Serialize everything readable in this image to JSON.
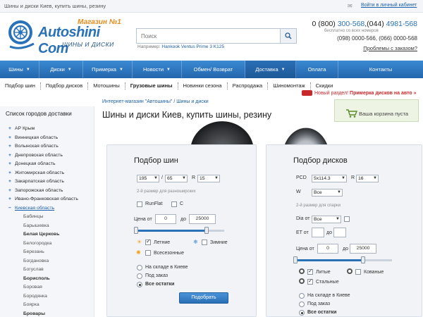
{
  "topbar": {
    "page_title": "Шины и диски Киев, купить шины, резину",
    "cabinet_link": "Войти в личный кабинет"
  },
  "header": {
    "logo_tagline": "Магазин №1",
    "logo_name": "Autoshini Com",
    "logo_sub": "ШИНЫ И ДИСКИ",
    "search_placeholder": "Поиск",
    "example_label": "Например:",
    "example_link": "Hankook Ventus Prime 3 K125",
    "phone_main_prefix": "0 (800)",
    "phone_main_num": "300-568",
    "phone_main_sep": ",(044)",
    "phone_main_num2": "4981-568",
    "phone_free_note": "бесплатно со всех номеров",
    "phone_secondary": "(098) 0000-566, (066) 0000-568",
    "problems_link": "Проблемы с заказом?"
  },
  "nav": [
    {
      "label": "Шины",
      "chevron": true
    },
    {
      "label": "Диски",
      "chevron": true
    },
    {
      "label": "Примерка",
      "chevron": true
    },
    {
      "label": "Новости",
      "chevron": true
    },
    {
      "label": "Обмен/ Возврат",
      "chevron": false
    },
    {
      "label": "Доставка",
      "chevron": true,
      "active": true
    },
    {
      "label": "Оплата",
      "chevron": false
    },
    {
      "label": "Контакты",
      "chevron": false
    }
  ],
  "subnav": [
    {
      "label": "Подбор шин"
    },
    {
      "label": "Подбор дисков"
    },
    {
      "label": "Мотошины"
    },
    {
      "label": "Грузовые шины",
      "bold": true
    },
    {
      "label": "Новинки сезона"
    },
    {
      "label": "Распродажа"
    },
    {
      "label": "Шиномонтаж"
    },
    {
      "label": "Скидки"
    }
  ],
  "promo": {
    "prefix": "Новый раздел!",
    "link": "Примерка дисков на авто »"
  },
  "breadcrumb": {
    "home": "Интернет-магазин \"Автошины\"",
    "sep": " / ",
    "current": "Шины и диски"
  },
  "page_title": "Шины и диски Киев, купить шины, резину",
  "cart": {
    "label": "Ваша корзина пуста"
  },
  "sidebar": {
    "heading": "Список городов доставки",
    "regions": [
      {
        "sign": "+",
        "label": "АР Крым"
      },
      {
        "sign": "+",
        "label": "Винницкая область"
      },
      {
        "sign": "+",
        "label": "Волынская область"
      },
      {
        "sign": "+",
        "label": "Днепровская область"
      },
      {
        "sign": "+",
        "label": "Донецкая область"
      },
      {
        "sign": "+",
        "label": "Житомирская область"
      },
      {
        "sign": "+",
        "label": "Закарпатская область"
      },
      {
        "sign": "+",
        "label": "Запорожская область"
      },
      {
        "sign": "+",
        "label": "Ивано-Франковская область"
      },
      {
        "sign": "−",
        "label": "Киевская область",
        "open": true
      }
    ],
    "cities": [
      {
        "label": "Бабинцы"
      },
      {
        "label": "Барышевка"
      },
      {
        "label": "Белая Церковь",
        "bold": true
      },
      {
        "label": "Белогородка"
      },
      {
        "label": "Березань"
      },
      {
        "label": "Богдановка"
      },
      {
        "label": "Богуслав"
      },
      {
        "label": "Борисполь",
        "bold": true
      },
      {
        "label": "Боровая"
      },
      {
        "label": "Бородянка"
      },
      {
        "label": "Боярка"
      },
      {
        "label": "Бровары",
        "bold": true
      }
    ]
  },
  "tires": {
    "title": "Подбор шин",
    "width": "195",
    "slash": "/",
    "profile": "65",
    "r_label": "R",
    "radius": "15",
    "second_size": "2-й размер для разноширских",
    "runflat": "RunFlat",
    "c_label": "C",
    "price_from": "Цена от",
    "price_min": "0",
    "price_to": "до",
    "price_max": "25000",
    "summer": "Летние",
    "winter": "Зимние",
    "allseason": "Всесезонные",
    "stock1": "На складе в Киеве",
    "stock2": "Под заказ",
    "stock3": "Все остатки",
    "button": "Подобрать"
  },
  "disks": {
    "title": "Подбор дисков",
    "pcd_label": "PCD",
    "pcd": "5x114.3",
    "r_label": "R",
    "radius": "16",
    "w_label": "W",
    "w": "Все",
    "second_size": "2-й размер для спарки",
    "dia_label": "Dia от",
    "dia": "Все",
    "et_label": "ET от",
    "et_to": "до",
    "price_from": "Цена от",
    "price_min": "0",
    "price_to": "до",
    "price_max": "25000",
    "cast": "Литые",
    "forged": "Кованые",
    "steel": "Стальные",
    "stock1": "На складе в Киеве",
    "stock2": "Под заказ",
    "stock3": "Все остатки"
  }
}
